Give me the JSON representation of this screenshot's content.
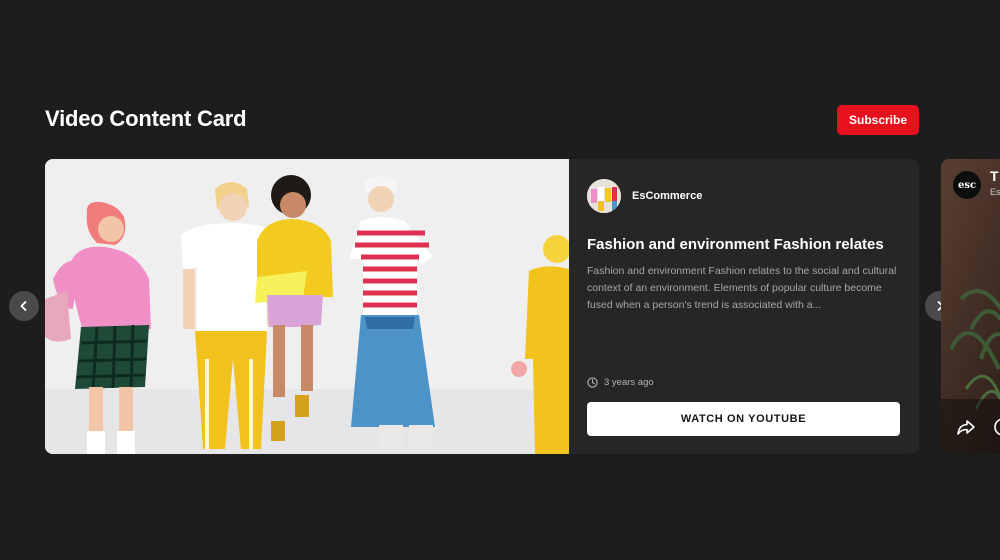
{
  "header": {
    "title": "Video Content Card",
    "subscribe_label": "Subscribe"
  },
  "card": {
    "channel_name": "EsCommerce",
    "title": "Fashion and environment Fashion relates",
    "description": "Fashion and environment Fashion relates to the social and cultural context of an environment. Elements of popular culture become fused when a person's trend is associated with a...",
    "published": "3 years ago",
    "cta_label": "WATCH ON YOUTUBE"
  },
  "next_card": {
    "channel_logo_text": "esc",
    "title": "T",
    "channel_name": "Es"
  },
  "icons": {
    "prev": "chevron-left-icon",
    "next": "chevron-right-icon",
    "clock": "clock-icon",
    "share": "share-icon",
    "info": "info-icon"
  },
  "colors": {
    "background": "#1d1d1e",
    "card": "#262627",
    "accent": "#e8101c",
    "cta_background": "#ffffff"
  }
}
